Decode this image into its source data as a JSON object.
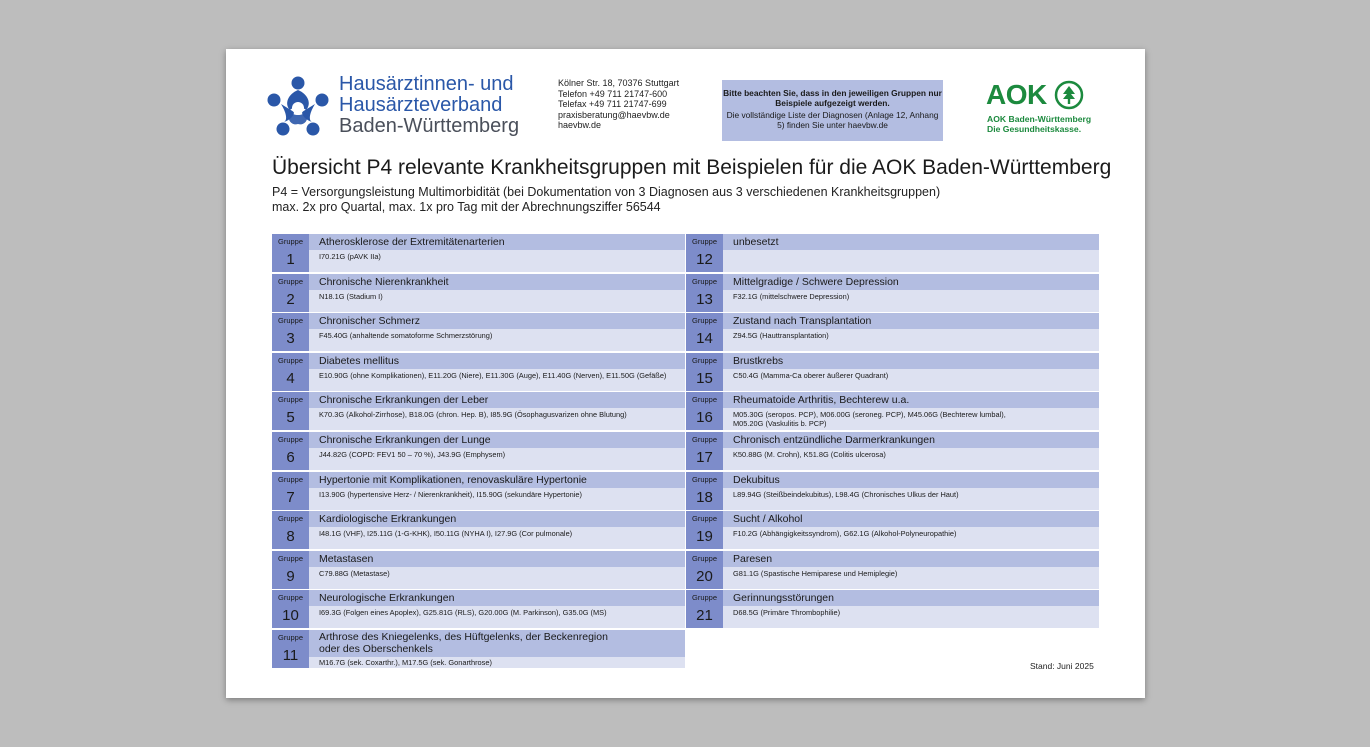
{
  "header": {
    "org_line1": "Hausärztinnen- und",
    "org_line2": "Hausärzteverband",
    "org_line3": "Baden-Württemberg",
    "contact": [
      "Kölner Str. 18, 70376 Stuttgart",
      "Telefon +49 711 21747-600",
      "Telefax +49 711 21747-699",
      "praxisberatung@haevbw.de",
      "haevbw.de"
    ],
    "notice_bold": "Bitte beachten Sie, dass in den jeweiligen Gruppen nur Beispiele aufgezeigt werden.",
    "notice_text": "Die vollständige Liste der Diagnosen (Anlage 12, Anhang 5) finden Sie unter haevbw.de",
    "aok_word": "AOK",
    "aok_sub1": "AOK Baden-Württemberg",
    "aok_sub2": "Die Gesundheitskasse.",
    "brand_blue": "#2a57a8",
    "brand_green": "#1c8a3e"
  },
  "title": "Übersicht P4 relevante Krankheitsgruppen mit Beispielen für die AOK Baden-Württemberg",
  "subtitle1": "P4 = Versorgungsleistung Multimorbidität (bei Dokumentation von 3 Diagnosen aus 3 verschiedenen Krankheitsgruppen)",
  "subtitle2": "max. 2x pro Quartal, max. 1x pro Tag mit der Abrechnungsziffer 56544",
  "group_label": "Gruppe",
  "colors": {
    "group_box": "#7d8cca",
    "group_head": "#b3bde1",
    "group_body": "#dde1f1"
  },
  "groups_left": [
    {
      "num": "1",
      "name": "Atherosklerose der Extremitätenarterien",
      "examples": "I70.21G (pAVK IIa)"
    },
    {
      "num": "2",
      "name": "Chronische Nierenkrankheit",
      "examples": "N18.1G (Stadium I)"
    },
    {
      "num": "3",
      "name": "Chronischer Schmerz",
      "examples": "F45.40G (anhaltende somatoforme Schmerzstörung)"
    },
    {
      "num": "4",
      "name": "Diabetes mellitus",
      "examples": "E10.90G (ohne Komplikationen), E11.20G (Niere), E11.30G (Auge), E11.40G (Nerven), E11.50G (Gefäße)"
    },
    {
      "num": "5",
      "name": "Chronische Erkrankungen der Leber",
      "examples": "K70.3G (Alkohol-Zirrhose), B18.0G (chron. Hep. B), I85.9G (Ösophagusvarizen ohne Blutung)"
    },
    {
      "num": "6",
      "name": "Chronische Erkrankungen der Lunge",
      "examples": "J44.82G (COPD: FEV1 50 – 70 %), J43.9G (Emphysem)"
    },
    {
      "num": "7",
      "name": "Hypertonie mit Komplikationen, renovaskuläre Hypertonie",
      "examples": "I13.90G (hypertensive Herz- / Nierenkrankheit), I15.90G (sekundäre Hypertonie)"
    },
    {
      "num": "8",
      "name": "Kardiologische Erkrankungen",
      "examples": "I48.1G (VHF), I25.11G (1-G-KHK), I50.11G (NYHA I), I27.9G (Cor pulmonale)"
    },
    {
      "num": "9",
      "name": "Metastasen",
      "examples": "C79.88G (Metastase)"
    },
    {
      "num": "10",
      "name": "Neurologische Erkrankungen",
      "examples": "I69.3G (Folgen eines Apoplex), G25.81G (RLS), G20.00G (M. Parkinson), G35.0G (MS)"
    },
    {
      "num": "11",
      "name": "Arthrose des Kniegelenks, des Hüftgelenks, der Beckenregion",
      "name2": "oder des Oberschenkels",
      "examples": "M16.7G (sek. Coxarthr.), M17.5G (sek. Gonarthrose)"
    }
  ],
  "groups_right": [
    {
      "num": "12",
      "name": "unbesetzt",
      "examples": ""
    },
    {
      "num": "13",
      "name": "Mittelgradige / Schwere Depression",
      "examples": "F32.1G (mittelschwere Depression)"
    },
    {
      "num": "14",
      "name": "Zustand nach Transplantation",
      "examples": "Z94.5G (Hauttransplantation)"
    },
    {
      "num": "15",
      "name": "Brustkrebs",
      "examples": "C50.4G (Mamma-Ca oberer äußerer Quadrant)"
    },
    {
      "num": "16",
      "name": "Rheumatoide Arthritis, Bechterew u.a.",
      "examples": "M05.30G (seropos. PCP), M06.00G (seroneg. PCP), M45.06G (Bechterew lumbal),",
      "examples2": "M05.20G (Vaskulitis b. PCP)"
    },
    {
      "num": "17",
      "name": "Chronisch entzündliche Darmerkrankungen",
      "examples": "K50.88G (M. Crohn), K51.8G (Colitis ulcerosa)"
    },
    {
      "num": "18",
      "name": "Dekubitus",
      "examples": "L89.94G (Steißbeindekubitus), L98.4G (Chronisches Ulkus der Haut)"
    },
    {
      "num": "19",
      "name": "Sucht / Alkohol",
      "examples": "F10.2G (Abhängigkeitssyndrom), G62.1G (Alkohol-Polyneuropathie)"
    },
    {
      "num": "20",
      "name": "Paresen",
      "examples": "G81.1G (Spastische Hemiparese und Hemiplegie)"
    },
    {
      "num": "21",
      "name": "Gerinnungsstörungen",
      "examples": "D68.5G (Primäre Thrombophilie)"
    }
  ],
  "stand": "Stand: Juni 2025"
}
